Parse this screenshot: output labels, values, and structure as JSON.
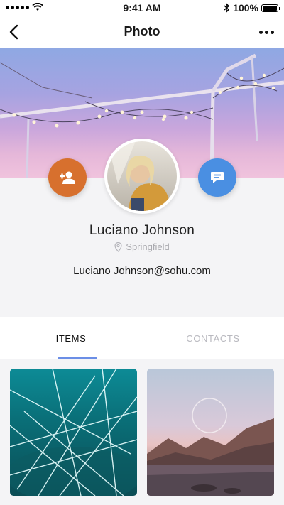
{
  "status_bar": {
    "time": "9:41 AM",
    "battery_text": "100%",
    "battery_level": 1.0,
    "icons": [
      "signal-icon",
      "wifi-icon",
      "bluetooth-icon",
      "battery-icon"
    ]
  },
  "nav": {
    "title": "Photo",
    "back_icon": "chevron-left-icon",
    "more_icon": "more-horizontal-icon"
  },
  "profile": {
    "name": "Luciano Johnson",
    "location": "Springfield",
    "email": "Luciano Johnson@sohu.com",
    "add_contact_icon": "add-person-icon",
    "message_icon": "chat-bubble-icon",
    "add_color": "#d7702e",
    "message_color": "#4a8fe2"
  },
  "tabs": [
    {
      "label": "ITEMS",
      "active": true
    },
    {
      "label": "CONTACTS",
      "active": false
    }
  ],
  "accent": "#6b8ee6"
}
